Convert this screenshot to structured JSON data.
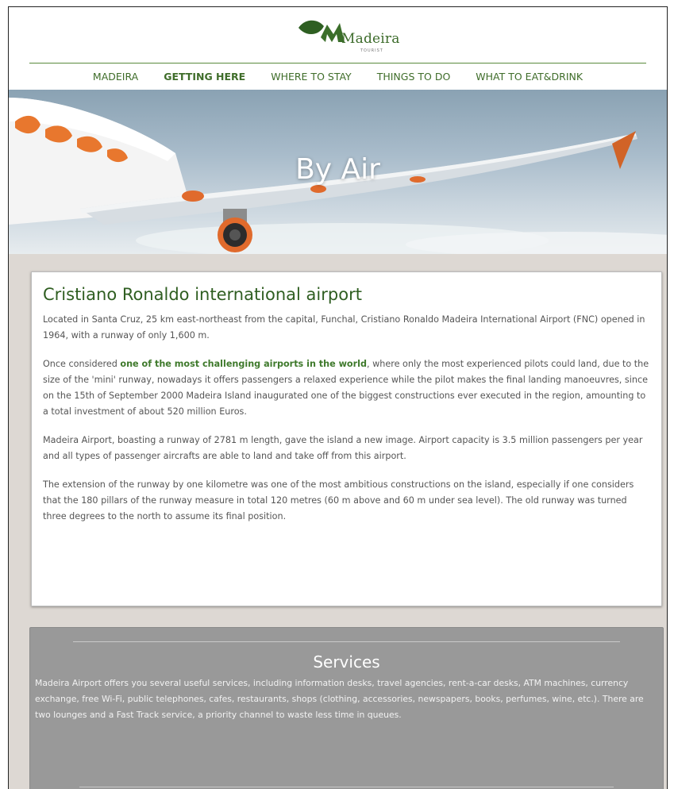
{
  "logo": {
    "word": "Madeira",
    "sub": "TOURIST"
  },
  "nav": {
    "items": [
      "MADEIRA",
      "GETTING HERE",
      "WHERE TO STAY",
      "THINGS TO DO",
      "WHAT TO EAT&DRINK"
    ],
    "active": "GETTING HERE"
  },
  "hero": {
    "title": "By Air"
  },
  "article": {
    "title": "Cristiano Ronaldo international airport",
    "p1": "Located in Santa Cruz, 25 km east-northeast from the capital, Funchal, Cristiano Ronaldo Madeira International Airport (FNC) opened in 1964, with a runway of only 1,600 m.",
    "p2_before": "Once considered ",
    "p2_highlight": "one of the most challenging airports in the world",
    "p2_after": ", where only the most experienced pilots could land, due to the size of the 'mini' runway, nowadays it offers passengers a relaxed experience while the pilot makes the final landing manoeuvres, since on the 15th of September 2000 Madeira Island inaugurated one of the biggest constructions ever executed in the region, amounting to a total investment of about 520 million Euros.",
    "p3": "Madeira Airport, boasting a runway of 2781 m length, gave the island a new image. Airport capacity is 3.5 million passengers per year and all types of passenger aircrafts are able to land and take off from this airport.",
    "p4": "The extension of the runway by one kilometre was one of the most ambitious constructions on the island, especially if one considers that the 180 pillars of the runway measure in total 120 metres (60 m above and 60 m under sea level). The old runway was turned three degrees to the north to assume its final position."
  },
  "services": {
    "title": "Services",
    "text": "Madeira Airport offers you several useful services, including information desks, travel agencies, rent-a-car desks, ATM machines, currency exchange, free Wi-Fi, public telephones, cafes, restaurants, shops (clothing, accessories, newspapers, books, perfumes, wine, etc.). There are two lounges and a Fast Track service, a priority channel to waste less time in queues."
  },
  "colors": {
    "brand_green": "#3f6d2a",
    "services_bg": "#999999",
    "page_bg": "#ddd8d3",
    "accent_orange": "#e06a2c"
  }
}
